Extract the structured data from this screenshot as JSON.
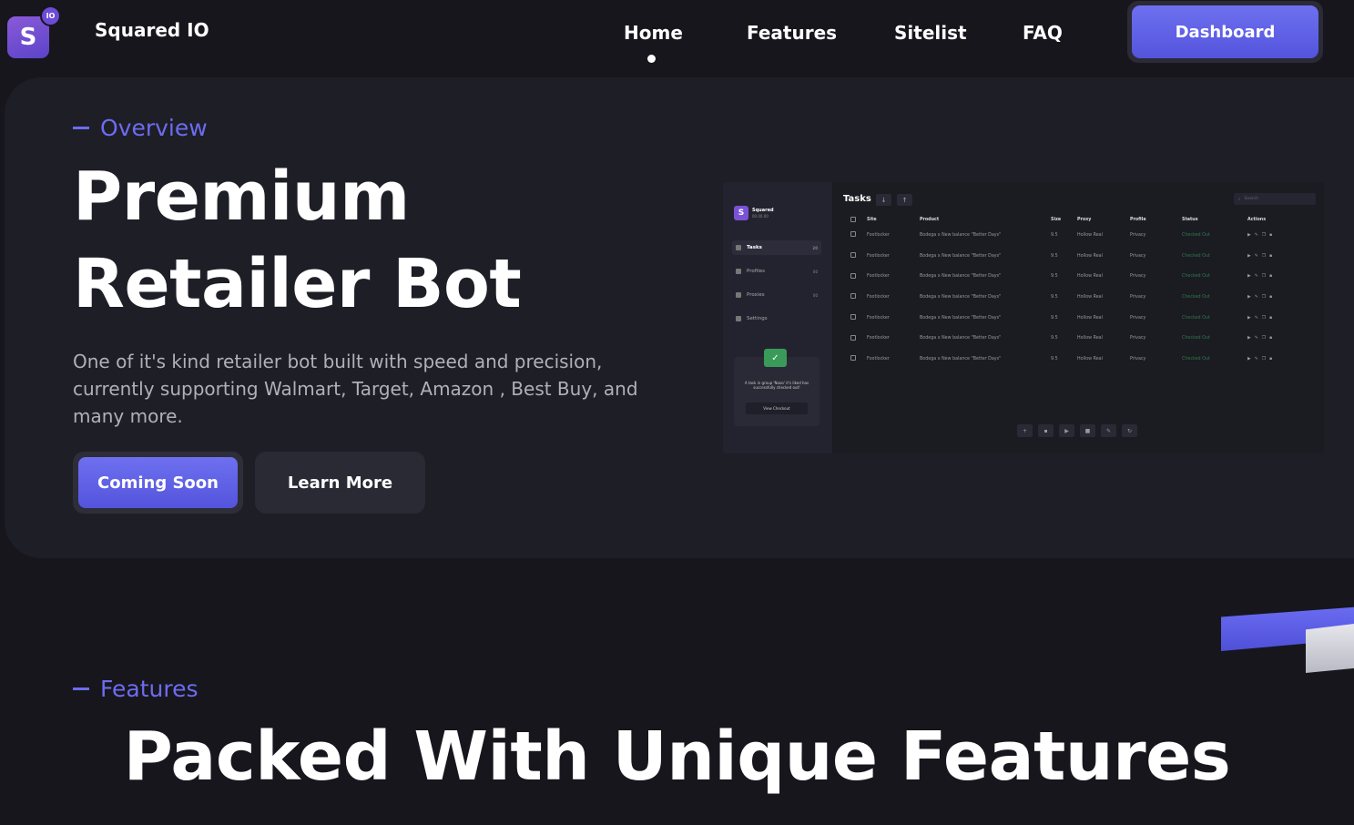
{
  "brand": {
    "name": "Squared IO",
    "logo_letter": "S",
    "logo_badge": "IO"
  },
  "nav": {
    "items": [
      "Home",
      "Features",
      "Sitelist",
      "FAQ"
    ],
    "active": "Home",
    "dashboard_label": "Dashboard"
  },
  "hero": {
    "eyebrow": "Overview",
    "title_line1": "Premium",
    "title_line2": "Retailer Bot",
    "description": "One of it's kind retailer bot built with speed and precision, currently supporting Walmart, Target, Amazon , Best Buy, and many more.",
    "primary_button": "Coming Soon",
    "secondary_button": "Learn More"
  },
  "preview": {
    "brand": "Squared",
    "version": "00.00.00",
    "title": "Tasks",
    "search_placeholder": "Search",
    "sidebar": [
      {
        "label": "Tasks",
        "count": "20",
        "active": true
      },
      {
        "label": "Profiles",
        "count": "00",
        "active": false
      },
      {
        "label": "Proxies",
        "count": "00",
        "active": false
      },
      {
        "label": "Settings",
        "count": "",
        "active": false
      }
    ],
    "notification": {
      "text": "A task in group 'Nooo' it's liked has successfully checked out!",
      "button": "View Checkout"
    },
    "columns": [
      "Site",
      "Product",
      "Size",
      "Proxy",
      "Profile",
      "Status",
      "Actions"
    ],
    "rows": [
      {
        "site": "Footlocker",
        "product": "Bodega x New balance \"Better Days\"",
        "size": "9.5",
        "proxy": "Hollow Real",
        "profile": "Privacy",
        "status": "Checked Out"
      },
      {
        "site": "Footlocker",
        "product": "Bodega x New balance \"Better Days\"",
        "size": "9.5",
        "proxy": "Hollow Real",
        "profile": "Privacy",
        "status": "Checked Out"
      },
      {
        "site": "Footlocker",
        "product": "Bodega x New balance \"Better Days\"",
        "size": "9.5",
        "proxy": "Hollow Real",
        "profile": "Privacy",
        "status": "Checked Out"
      },
      {
        "site": "Footlocker",
        "product": "Bodega x New balance \"Better Days\"",
        "size": "9.5",
        "proxy": "Hollow Real",
        "profile": "Privacy",
        "status": "Checked Out"
      },
      {
        "site": "Footlocker",
        "product": "Bodega x New balance \"Better Days\"",
        "size": "9.5",
        "proxy": "Hollow Real",
        "profile": "Privacy",
        "status": "Checked Out"
      },
      {
        "site": "Footlocker",
        "product": "Bodega x New balance \"Better Days\"",
        "size": "9.5",
        "proxy": "Hollow Real",
        "profile": "Privacy",
        "status": "Checked Out"
      },
      {
        "site": "Footlocker",
        "product": "Bodega x New balance \"Better Days\"",
        "size": "9.5",
        "proxy": "Hollow Real",
        "profile": "Privacy",
        "status": "Checked Out"
      }
    ],
    "row_actions": [
      "play-icon",
      "edit-icon",
      "copy-icon",
      "trash-icon"
    ],
    "bottom_actions": [
      "add-icon",
      "trash-icon",
      "play-icon",
      "stop-icon",
      "edit-icon",
      "refresh-icon"
    ]
  },
  "features": {
    "eyebrow": "Features",
    "title": "Packed With Unique Features"
  },
  "colors": {
    "background": "#17161d",
    "panel": "#1e1e27",
    "accent": "#6c6cf0",
    "button_gradient_top": "#6e70f0",
    "button_gradient_bottom": "#5354dc",
    "status_green": "#2f7a4a"
  }
}
